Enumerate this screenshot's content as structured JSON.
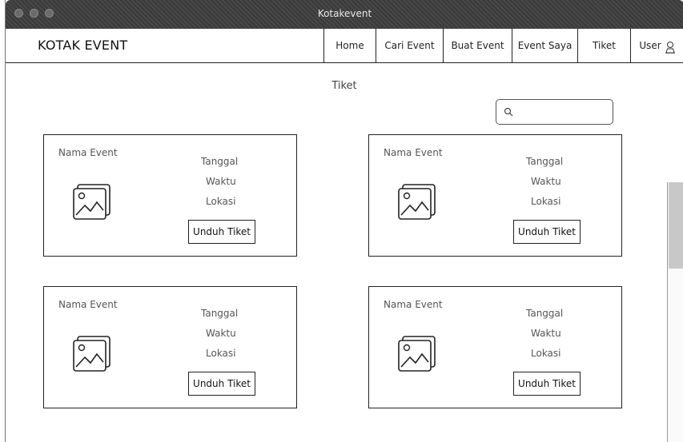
{
  "window": {
    "title": "Kotakevent",
    "dots": [
      "close",
      "minimize",
      "zoom"
    ]
  },
  "navbar": {
    "brand": "KOTAK EVENT",
    "items": [
      {
        "label": "Home"
      },
      {
        "label": "Cari Event"
      },
      {
        "label": "Buat Event"
      },
      {
        "label": "Event Saya"
      },
      {
        "label": "Tiket"
      },
      {
        "label": "User",
        "icon": "user-icon"
      }
    ]
  },
  "page": {
    "heading": "Tiket"
  },
  "search": {
    "icon": "search-icon",
    "value": "",
    "placeholder": ""
  },
  "tickets": [
    {
      "name": "Nama Event",
      "date": "Tanggal",
      "time": "Waktu",
      "location": "Lokasi",
      "button": "Unduh Tiket",
      "icon": "image-icon"
    },
    {
      "name": "Nama Event",
      "date": "Tanggal",
      "time": "Waktu",
      "location": "Lokasi",
      "button": "Unduh Tiket",
      "icon": "image-icon"
    },
    {
      "name": "Nama Event",
      "date": "Tanggal",
      "time": "Waktu",
      "location": "Lokasi",
      "button": "Unduh Tiket",
      "icon": "image-icon"
    },
    {
      "name": "Nama Event",
      "date": "Tanggal",
      "time": "Waktu",
      "location": "Lokasi",
      "button": "Unduh Tiket",
      "icon": "image-icon"
    }
  ],
  "colors": {
    "titlebar": "#3a3a3a",
    "border": "#222222",
    "scroll_thumb": "#c8c8c8"
  }
}
